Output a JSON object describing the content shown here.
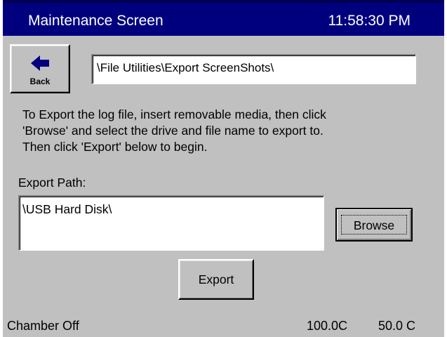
{
  "header": {
    "title": "Maintenance Screen",
    "time": "11:58:30 PM"
  },
  "navigation": {
    "back_label": "Back",
    "current_path": "\\File Utilities\\Export ScreenShots\\"
  },
  "instructions": {
    "line1": "To Export the log file, insert removable media, then click",
    "line2": "'Browse' and select the drive and file name to export to.",
    "line3": "Then click 'Export' below to begin."
  },
  "export": {
    "path_label": "Export Path:",
    "path_value": "\\USB Hard Disk\\",
    "browse_label": "Browse",
    "export_label": "Export"
  },
  "status": {
    "chamber_state": "Chamber Off",
    "temperature": "100.0C",
    "setpoint": "50.0 C"
  },
  "colors": {
    "title_bar": "#00007f",
    "panel_background": "#c0c0c0"
  },
  "icons": {
    "back": "left-arrow-icon"
  }
}
